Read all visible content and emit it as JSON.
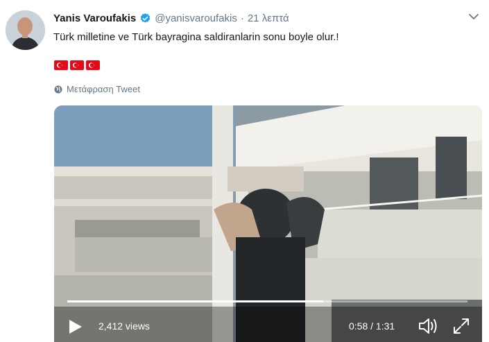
{
  "tweet": {
    "author_name": "Yanis Varoufakis",
    "handle": "@yanisvaroufakis",
    "separator": "·",
    "time": "21 λεπτά",
    "text": "Türk milletine ve Türk bayragina saldiranlarin sonu boyle olur.!",
    "flags": [
      "turkey-flag",
      "turkey-flag",
      "turkey-flag"
    ],
    "translate_label": "Μετάφραση Tweet"
  },
  "video": {
    "views": "2,412 views",
    "timecode": "0:58 / 1:31",
    "progress": 0.64
  },
  "colors": {
    "verified": "#1da1f2",
    "secondary_text": "#657786",
    "flag_red": "#e30a17"
  },
  "icons": [
    "verified-badge-icon",
    "chevron-down-icon",
    "globe-icon",
    "play-icon",
    "volume-icon",
    "fullscreen-icon"
  ]
}
